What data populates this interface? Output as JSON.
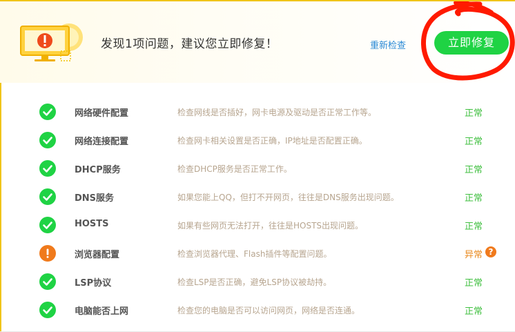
{
  "header": {
    "headline": "发现1项问题，建议您立即修复！",
    "recheck_label": "重新检查",
    "fix_button_label": "立即修复",
    "hero_icon": "warning-monitor-icon"
  },
  "colors": {
    "accent_green": "#1fd344",
    "ok_green": "#3fbf3f",
    "warning_orange": "#f07a1c",
    "link_blue": "#2b8ad6",
    "annotation_red": "#ff1a00"
  },
  "items": [
    {
      "name": "网络硬件配置",
      "desc": "检查网线是否插好，网卡电源及驱动是否正常工作等。",
      "status": "正常",
      "ok": true
    },
    {
      "name": "网络连接配置",
      "desc": "检查网卡相关设置是否正确，IP地址是否配置正确。",
      "status": "正常",
      "ok": true
    },
    {
      "name": "DHCP服务",
      "desc": "检查DHCP服务是否正常工作。",
      "status": "正常",
      "ok": true
    },
    {
      "name": "DNS服务",
      "desc": "如果您能上QQ，但打不开网页，往往是DNS服务出现问题。",
      "status": "正常",
      "ok": true
    },
    {
      "name": "HOSTS",
      "desc": "如果有些网页无法打开，往往是HOSTS出现问题。",
      "status": "正常",
      "ok": true
    },
    {
      "name": "浏览器配置",
      "desc": "检查浏览器代理、Flash插件等配置问题。",
      "status": "异常",
      "ok": false,
      "help": "?"
    },
    {
      "name": "LSP协议",
      "desc": "检查LSP是否正确，避免LSP协议被劫持。",
      "status": "正常",
      "ok": true
    },
    {
      "name": "电脑能否上网",
      "desc": "检查您的电脑是否可以访问网页，网络是否连通。",
      "status": "正常",
      "ok": true
    }
  ]
}
